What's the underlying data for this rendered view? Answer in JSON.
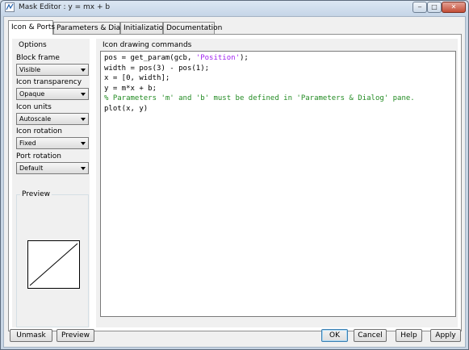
{
  "window": {
    "title": "Mask Editor : y = mx + b",
    "minimize_glyph": "‒",
    "maximize_glyph": "□",
    "close_glyph": "✕"
  },
  "tabs": [
    {
      "label": "Icon & Ports",
      "active": true
    },
    {
      "label": "Parameters & Dialog",
      "active": false
    },
    {
      "label": "Initialization",
      "active": false
    },
    {
      "label": "Documentation",
      "active": false
    }
  ],
  "options": {
    "heading": "Options",
    "block_frame": {
      "label": "Block frame",
      "value": "Visible"
    },
    "icon_transparency": {
      "label": "Icon transparency",
      "value": "Opaque"
    },
    "icon_units": {
      "label": "Icon units",
      "value": "Autoscale"
    },
    "icon_rotation": {
      "label": "Icon rotation",
      "value": "Fixed"
    },
    "port_rotation": {
      "label": "Port rotation",
      "value": "Default"
    }
  },
  "preview": {
    "label": "Preview"
  },
  "commands": {
    "label": "Icon drawing commands",
    "lines": [
      {
        "pre": "pos = get_param(gcb, ",
        "str": "'Position'",
        "post": ");"
      },
      {
        "pre": "width = pos(3) - pos(1);"
      },
      {
        "pre": "x = [0, width];"
      },
      {
        "pre": "y = m*x + b;"
      },
      {
        "comment": "% Parameters 'm' and 'b' must be defined in 'Parameters & Dialog' pane."
      },
      {
        "pre": "plot(x, y)"
      }
    ]
  },
  "buttons": {
    "unmask": "Unmask",
    "preview": "Preview",
    "ok": "OK",
    "cancel": "Cancel",
    "help": "Help",
    "apply": "Apply"
  },
  "colors": {
    "string": "#a020f0",
    "comment": "#228b22",
    "close_button": "#c44d36"
  }
}
